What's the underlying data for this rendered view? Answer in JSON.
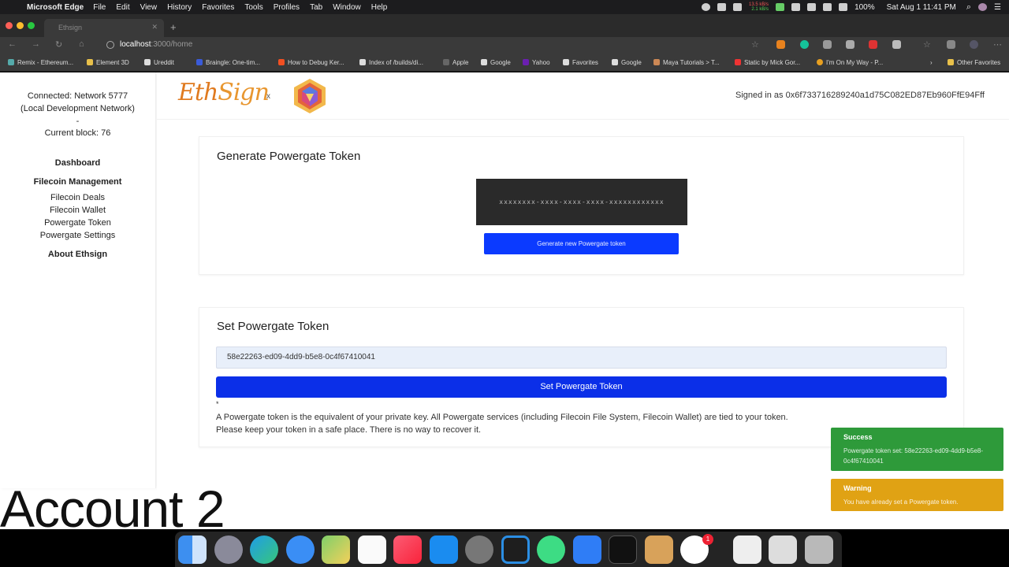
{
  "menubar": {
    "app": "Microsoft Edge",
    "items": [
      "File",
      "Edit",
      "View",
      "History",
      "Favorites",
      "Tools",
      "Profiles",
      "Tab",
      "Window",
      "Help"
    ],
    "net_up": "13.5 kB/s",
    "net_down": "2.1 kB/s",
    "battery": "100%",
    "datetime": "Sat Aug 1  11:41 PM"
  },
  "browser": {
    "tab_title": "Ethsign",
    "address_host": "localhost",
    "address_path": ":3000/home"
  },
  "favorites": [
    "Remix - Ethereum...",
    "Element 3D",
    "Ureddit",
    "Braingle: One-tim...",
    "How to Debug Ker...",
    "Index of /builds/di...",
    "Apple",
    "Google",
    "Yahoo",
    "Favorites",
    "Google",
    "Maya Tutorials > T...",
    "Static by Mick Gor...",
    "I'm On My Way - P...",
    "Other Favorites"
  ],
  "sidebar": {
    "connected_line1": "Connected: Network 5777",
    "connected_line2": "(Local Development Network)",
    "dash": "-",
    "current_block": "Current block: 76",
    "dashboard": "Dashboard",
    "filecoin_management": "Filecoin Management",
    "filecoin_deals": "Filecoin Deals",
    "filecoin_wallet": "Filecoin Wallet",
    "powergate_token": "Powergate Token",
    "powergate_settings": "Powergate Settings",
    "about": "About Ethsign"
  },
  "header": {
    "logo_eth": "Eth",
    "logo_sign": "Sign",
    "times": "x",
    "signed_in": "Signed in as 0x6f733716289240a1d75C082ED87Eb960FfE94Fff"
  },
  "generate": {
    "title": "Generate Powergate Token",
    "token_placeholder": "xxxxxxxx-xxxx-xxxx-xxxx-xxxxxxxxxxxx",
    "button": "Generate new Powergate token"
  },
  "set_token": {
    "title": "Set Powergate Token",
    "input_value": "58e22263-ed09-4dd9-b5e8-0c4f67410041",
    "button": "Set Powergate Token",
    "asterisk": "*",
    "note_line1": "A Powergate token is the equivalent of your private key. All Powergate services (including Filecoin File System, Filecoin Wallet) are tied to your token.",
    "note_line2": "Please keep your token in a safe place. There is no way to recover it."
  },
  "toasts": {
    "success_title": "Success",
    "success_body": "Powergate token set: 58e22263-ed09-4dd9-b5e8-0c4f67410041",
    "warning_title": "Warning",
    "warning_body": "You have already set a Powergate token."
  },
  "overlay_text": "Account 2",
  "dock_badge": "1",
  "colors": {
    "primary_button": "#0b2fe8",
    "success": "#2e9a3a",
    "warning": "#e0a214",
    "logo": "#e07a1f"
  }
}
